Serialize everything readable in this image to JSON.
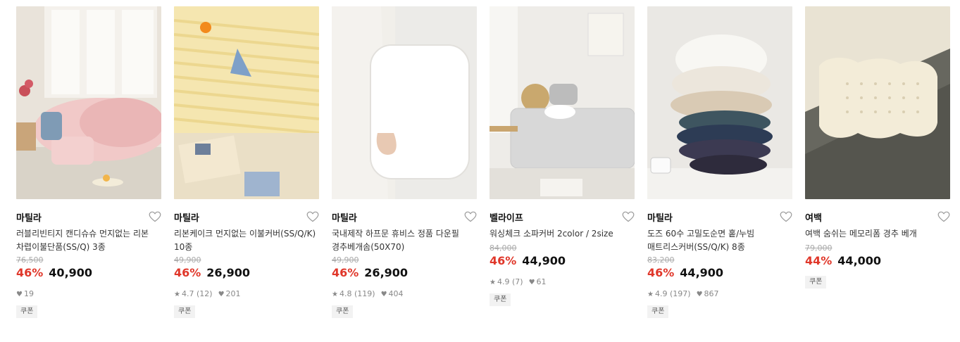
{
  "products": [
    {
      "brand": "마틸라",
      "title": "러블리빈티지 캔디슈슈 먼지없는 리본 차렵이불단품(SS/Q) 3종",
      "original_price": "76,500",
      "discount": "46%",
      "price": "40,900",
      "rating": "",
      "reviews": "",
      "likes": "19",
      "coupon": "쿠폰"
    },
    {
      "brand": "마틸라",
      "title": "리본케이크 먼지없는 이불커버(SS/Q/K) 10종",
      "original_price": "49,900",
      "discount": "46%",
      "price": "26,900",
      "rating": "4.7",
      "reviews": "(12)",
      "likes": "201",
      "coupon": "쿠폰"
    },
    {
      "brand": "마틸라",
      "title": "국내제작 하프문 휴비스 정품 다운필 경추베개솜(50X70)",
      "original_price": "49,900",
      "discount": "46%",
      "price": "26,900",
      "rating": "4.8",
      "reviews": "(119)",
      "likes": "404",
      "coupon": "쿠폰"
    },
    {
      "brand": "벨라이프",
      "title": "워싱체크 소파커버 2color / 2size",
      "original_price": "84,000",
      "discount": "46%",
      "price": "44,900",
      "rating": "4.9",
      "reviews": "(7)",
      "likes": "61",
      "coupon": "쿠폰"
    },
    {
      "brand": "마틸라",
      "title": "도즈 60수 고밀도순면 홑/누빔 매트리스커버(SS/Q/K) 8종",
      "original_price": "83,200",
      "discount": "46%",
      "price": "44,900",
      "rating": "4.9",
      "reviews": "(197)",
      "likes": "867",
      "coupon": "쿠폰"
    },
    {
      "brand": "여백",
      "title": "여백 숨쉬는 메모리폼 경추 베개",
      "original_price": "79,000",
      "discount": "44%",
      "price": "44,000",
      "rating": "",
      "reviews": "",
      "likes": "",
      "coupon": "쿠폰"
    }
  ],
  "colors": {
    "discount": "#e0372a",
    "star": "#999999",
    "heart_meta": "#999999"
  },
  "icons": {
    "wishlist": "heart-outline-icon",
    "star": "star-icon",
    "like": "heart-filled-icon"
  }
}
